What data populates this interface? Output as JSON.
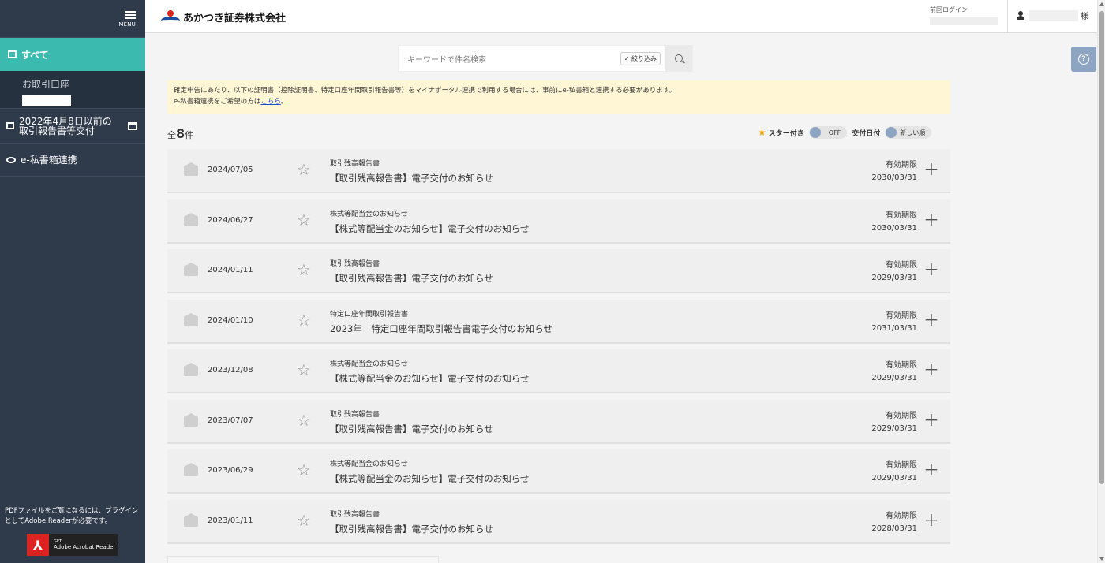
{
  "sidebar": {
    "menu_label": "MENU",
    "all_label": "すべて",
    "account_label": "お取引口座",
    "old_reports_line1": "2022年4月8日以前の",
    "old_reports_line2": "取引報告書等交付",
    "epriv_label": "e-私書箱連携",
    "pdf_note": "PDFファイルをご覧になるには、プラグインとしてAdobe Readerが必要です。",
    "acrobat_get": "GET",
    "acrobat_name": "Adobe Acrobat Reader"
  },
  "header": {
    "brand": "あかつき証券株式会社",
    "last_login_label": "前回ログイン",
    "user_suffix": "様"
  },
  "search": {
    "placeholder": "キーワードで件名検索",
    "filter_label": "✓ 絞り込み"
  },
  "notice": {
    "line1": "確定申告にあたり、以下の証明書（控除証明書、特定口座年間取引報告書等）をマイナポータル連携で利用する場合には、事前にe-私書箱と連携する必要があります。",
    "line2_prefix": "e-私書箱連携をご希望の方は",
    "link": "こちら",
    "line2_suffix": "。"
  },
  "count": {
    "prefix": "全",
    "number": "8",
    "suffix": "件"
  },
  "controls": {
    "starred_label": "スター付き",
    "starred_state": "OFF",
    "date_label": "交付日付",
    "sort_state": "新しい順"
  },
  "expiry_label": "有効期限",
  "documents": [
    {
      "date": "2024/07/05",
      "category": "取引残高報告書",
      "title": "【取引残高報告書】電子交付のお知らせ",
      "expiry": "2030/03/31"
    },
    {
      "date": "2024/06/27",
      "category": "株式等配当金のお知らせ",
      "title": "【株式等配当金のお知らせ】電子交付のお知らせ",
      "expiry": "2030/03/31"
    },
    {
      "date": "2024/01/11",
      "category": "取引残高報告書",
      "title": "【取引残高報告書】電子交付のお知らせ",
      "expiry": "2029/03/31"
    },
    {
      "date": "2024/01/10",
      "category": "特定口座年間取引報告書",
      "title": "2023年　特定口座年間取引報告書電子交付のお知らせ",
      "expiry": "2031/03/31"
    },
    {
      "date": "2023/12/08",
      "category": "株式等配当金のお知らせ",
      "title": "【株式等配当金のお知らせ】電子交付のお知らせ",
      "expiry": "2029/03/31"
    },
    {
      "date": "2023/07/07",
      "category": "取引残高報告書",
      "title": "【取引残高報告書】電子交付のお知らせ",
      "expiry": "2029/03/31"
    },
    {
      "date": "2023/06/29",
      "category": "株式等配当金のお知らせ",
      "title": "【株式等配当金のお知らせ】電子交付のお知らせ",
      "expiry": "2029/03/31"
    },
    {
      "date": "2023/01/11",
      "category": "取引残高報告書",
      "title": "【取引残高報告書】電子交付のお知らせ",
      "expiry": "2028/03/31"
    }
  ],
  "colors": {
    "sidebar_bg": "#2f3a4b",
    "accent_teal": "#3bbbb0",
    "notice_bg": "#fff6d6",
    "toggle_knob": "#8ea4c3"
  }
}
